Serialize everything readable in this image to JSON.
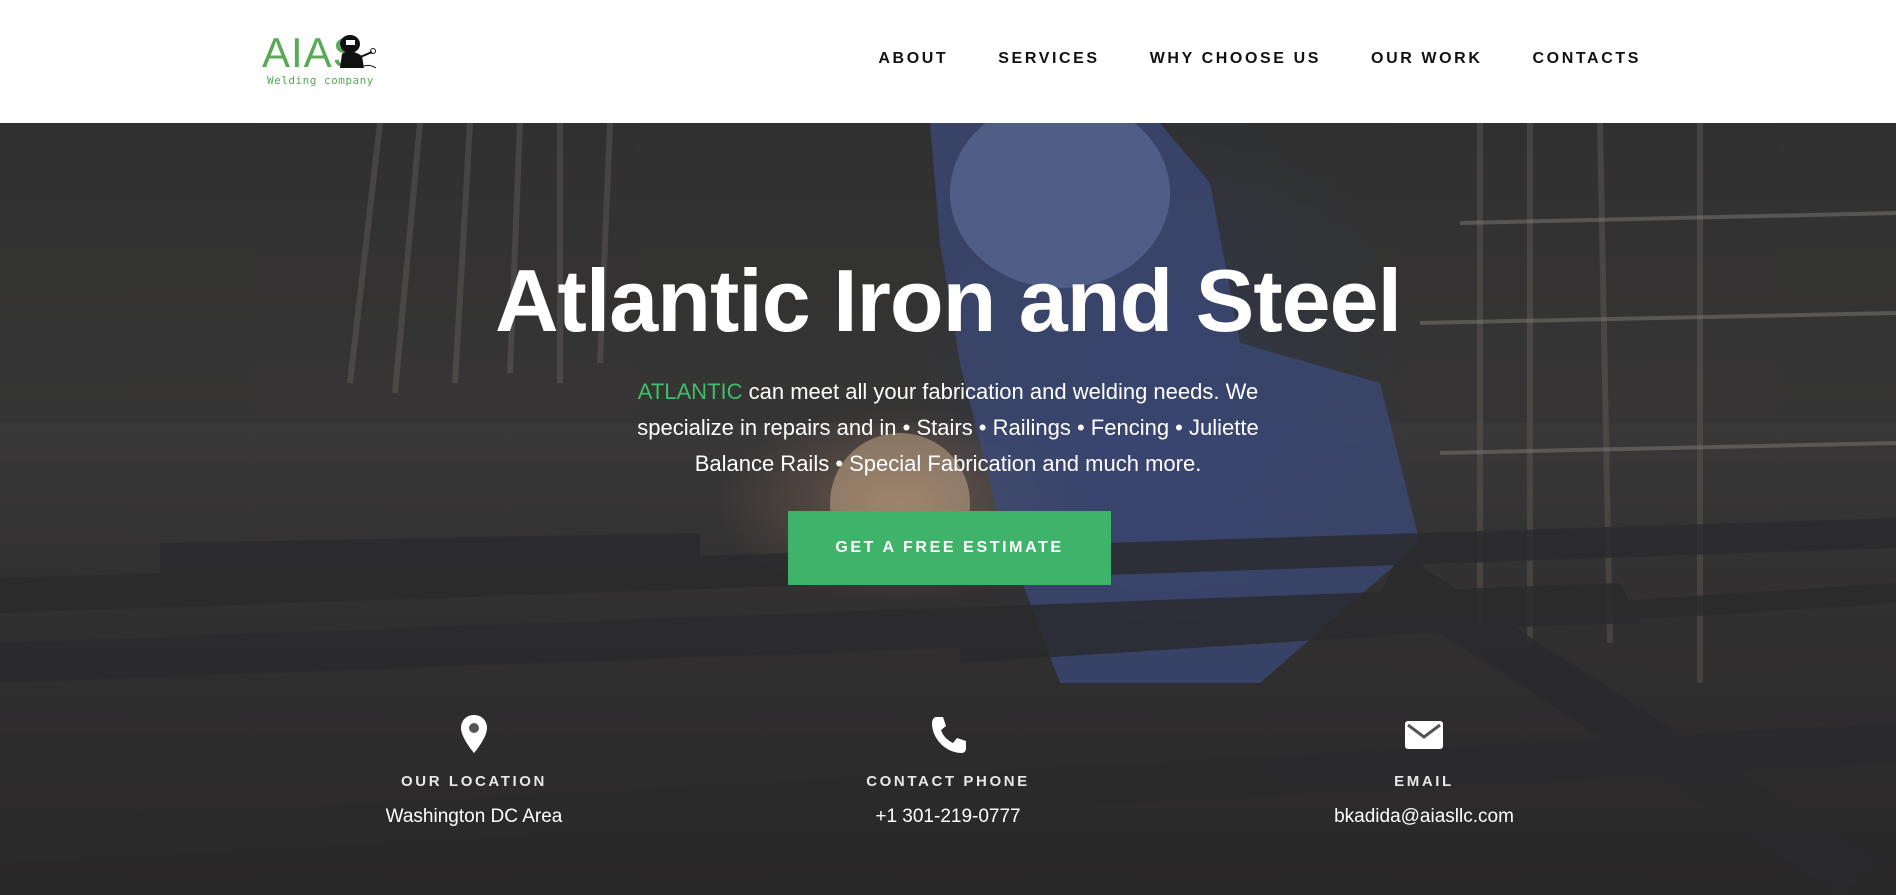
{
  "brand": {
    "logo_text": "AIAS",
    "logo_subtitle": "Welding company",
    "accent_color": "#5aa957"
  },
  "nav": {
    "items": [
      {
        "label": "ABOUT"
      },
      {
        "label": "SERVICES"
      },
      {
        "label": "WHY CHOOSE US"
      },
      {
        "label": "OUR WORK"
      },
      {
        "label": "CONTACTS"
      }
    ]
  },
  "hero": {
    "title": "Atlantic Iron and Steel",
    "text_accent": "ATLANTIC",
    "text_body": " can meet all your fabrication and welding needs. We specialize in repairs and in • Stairs • Railings • Fencing • Juliette Balance Rails • Special Fabrication and much more.",
    "cta_label": "GET A FREE ESTIMATE",
    "cta_color": "#3fb36a"
  },
  "info": [
    {
      "icon": "location-pin-icon",
      "label": "OUR LOCATION",
      "value": "Washington DC Area"
    },
    {
      "icon": "phone-icon",
      "label": "CONTACT PHONE",
      "value": "+1 301-219-0777"
    },
    {
      "icon": "envelope-icon",
      "label": "EMAIL",
      "value": "bkadida@aiasllc.com"
    }
  ]
}
